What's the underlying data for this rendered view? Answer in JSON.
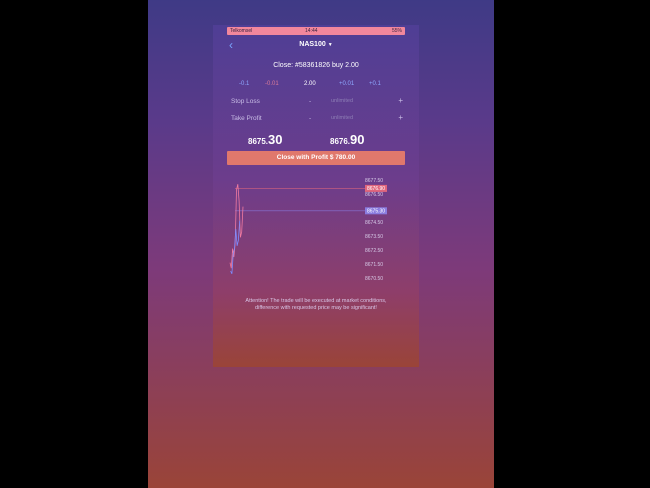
{
  "status_bar": {
    "carrier": "Telkomsel",
    "time": "14:44",
    "battery": "55%"
  },
  "nav": {
    "back_icon": "chevron-left-icon",
    "symbol": "NAS100"
  },
  "order": {
    "close_line": "Close: #58361826 buy 2.00",
    "quantity_steps": [
      "-0.1",
      "-0.01",
      "2.00",
      "+0.01",
      "+0.1"
    ],
    "stop_loss_label": "Stop Loss",
    "take_profit_label": "Take Profit",
    "placeholder": "unlimited",
    "minus": "-",
    "plus": "+"
  },
  "prices": {
    "bid_main": "8675.",
    "bid_pips": "30",
    "ask_main": "8676.",
    "ask_pips": "90"
  },
  "close_button": "Close with Profit $ 780.00",
  "chart_data": {
    "type": "line",
    "y_ticks": [
      "8677.50",
      "8676.90",
      "8676.50",
      "8675.30",
      "8674.50",
      "8673.50",
      "8672.50",
      "8671.50",
      "8670.50"
    ],
    "tags": [
      {
        "value": 8676.9,
        "label": "8676.90",
        "color": "#e0667d"
      },
      {
        "value": 8675.3,
        "label": "8675.30",
        "color": "#8a7ce0"
      }
    ],
    "ylim": [
      8670.5,
      8677.5
    ],
    "series": [
      {
        "color": "#f07aa0",
        "values": [
          8671.6,
          8671.2,
          8672.6,
          8672.0,
          8673.0,
          8676.8,
          8677.2,
          8676.0,
          8673.4,
          8673.8,
          8675.6
        ]
      },
      {
        "color": "#7d8cff",
        "values": [
          8671.0,
          8670.8,
          8672.2,
          8672.6,
          8674.0,
          8672.8,
          8673.2,
          8674.6
        ]
      }
    ]
  },
  "warning": "Attention! The trade will be executed at market conditions, difference with requested price may be significant!"
}
